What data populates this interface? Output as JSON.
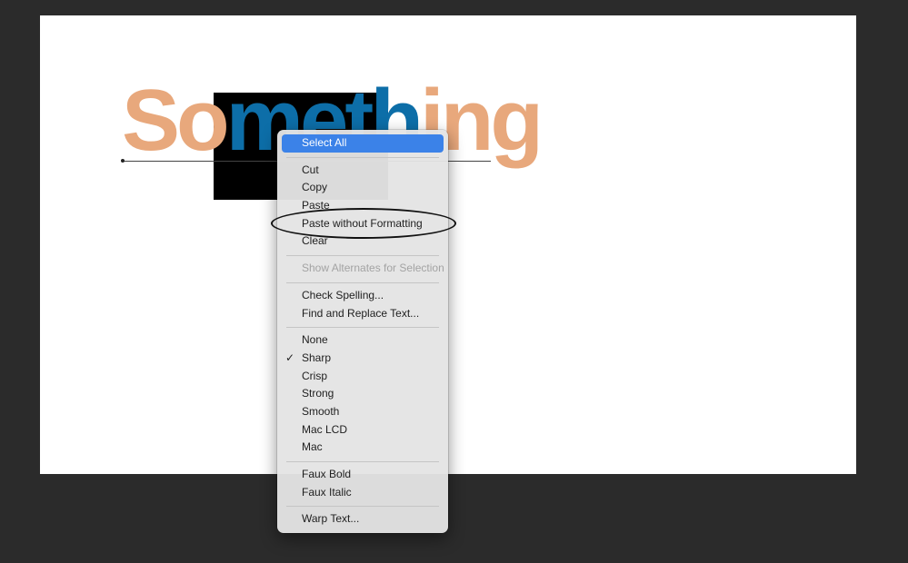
{
  "canvas_text": {
    "part_before": "So",
    "part_selected": "meth",
    "part_after": "ing",
    "unselected_color": "#e8a87c",
    "selected_color": "#0d6ea8",
    "selection_bg": "#000000"
  },
  "menu": {
    "groups": [
      [
        {
          "label": "Select All",
          "highlighted": true
        }
      ],
      [
        {
          "label": "Cut"
        },
        {
          "label": "Copy"
        },
        {
          "label": "Paste"
        },
        {
          "label": "Paste without Formatting",
          "annotated": true
        },
        {
          "label": "Clear"
        }
      ],
      [
        {
          "label": "Show Alternates for Selection",
          "disabled": true
        }
      ],
      [
        {
          "label": "Check Spelling..."
        },
        {
          "label": "Find and Replace Text..."
        }
      ],
      [
        {
          "label": "None"
        },
        {
          "label": "Sharp",
          "checked": true
        },
        {
          "label": "Crisp"
        },
        {
          "label": "Strong"
        },
        {
          "label": "Smooth"
        },
        {
          "label": "Mac LCD"
        },
        {
          "label": "Mac"
        }
      ],
      [
        {
          "label": "Faux Bold"
        },
        {
          "label": "Faux Italic"
        }
      ],
      [
        {
          "label": "Warp Text..."
        }
      ]
    ],
    "check_glyph": "✓",
    "highlight_color": "#3b82e8"
  }
}
